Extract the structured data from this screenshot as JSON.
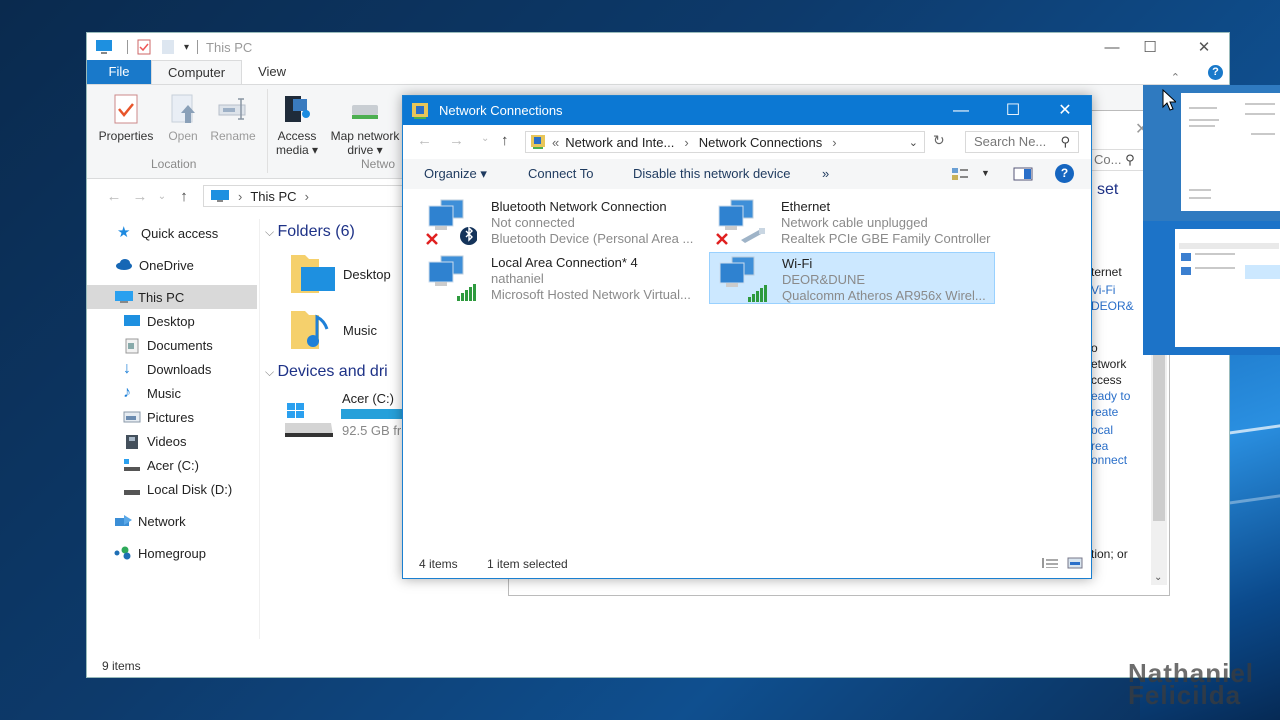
{
  "explorer": {
    "title": "This PC",
    "ribbon_tabs": [
      {
        "label": "File"
      },
      {
        "label": "Computer"
      },
      {
        "label": "View"
      }
    ],
    "ribbon_buttons": [
      {
        "label": "Properties",
        "enabled": true
      },
      {
        "label": "Open",
        "enabled": false
      },
      {
        "label": "Rename",
        "enabled": false
      },
      {
        "label": "Access media",
        "line1": "Access",
        "line2": "media ▾",
        "enabled": true
      },
      {
        "label": "Map network drive",
        "line1": "Map network",
        "line2": "drive ▾",
        "enabled": true
      }
    ],
    "ribbon_groups": [
      {
        "label": "Location"
      },
      {
        "label": "Netwo"
      }
    ],
    "address": {
      "crumb": "This PC",
      "sep": "›"
    },
    "nav_pane": [
      {
        "label": "Quick access",
        "icon": "star-icon"
      },
      {
        "label": "OneDrive",
        "icon": "cloud-icon"
      },
      {
        "label": "This PC",
        "icon": "computer-icon",
        "selected": true
      },
      {
        "label": "Desktop",
        "icon": "desktop-icon"
      },
      {
        "label": "Documents",
        "icon": "documents-icon"
      },
      {
        "label": "Downloads",
        "icon": "downloads-icon"
      },
      {
        "label": "Music",
        "icon": "music-icon"
      },
      {
        "label": "Pictures",
        "icon": "pictures-icon"
      },
      {
        "label": "Videos",
        "icon": "videos-icon"
      },
      {
        "label": "Acer (C:)",
        "icon": "drive-c-icon"
      },
      {
        "label": "Local Disk (D:)",
        "icon": "drive-d-icon"
      },
      {
        "label": "Network",
        "icon": "network-icon"
      },
      {
        "label": "Homegroup",
        "icon": "homegroup-icon"
      }
    ],
    "folders_header": "Folders (6)",
    "folders": [
      {
        "label": "Desktop"
      },
      {
        "label": "Music"
      }
    ],
    "devices_header": "Devices and dri",
    "drive": {
      "label": "Acer (C:)",
      "free": "92.5 GB fr"
    },
    "status": "9 items"
  },
  "network_connections": {
    "title": "Network Connections",
    "breadcrumb": [
      "«",
      "Network and Inte...",
      "›",
      "Network Connections",
      "›"
    ],
    "search_placeholder": "Search Ne...",
    "commands": [
      {
        "label": "Organize ▾"
      },
      {
        "label": "Connect To"
      },
      {
        "label": "Disable this network device"
      },
      {
        "label": "»"
      }
    ],
    "connections": [
      {
        "name": "Bluetooth Network Connection",
        "status": "Not connected",
        "device": "Bluetooth Device (Personal Area ...",
        "badge": "bluetooth",
        "disconnected": true,
        "selected": false
      },
      {
        "name": "Ethernet",
        "status": "Network cable unplugged",
        "device": "Realtek PCIe GBE Family Controller",
        "badge": "cable",
        "disconnected": true,
        "selected": false
      },
      {
        "name": "Local Area Connection* 4",
        "status": "nathaniel",
        "device": "Microsoft Hosted Network Virtual...",
        "badge": "signal",
        "disconnected": false,
        "selected": false
      },
      {
        "name": "Wi-Fi",
        "status": "DEOR&DUNE",
        "device": "Qualcomm Atheros AR956x Wirel...",
        "badge": "signal",
        "disconnected": false,
        "selected": true
      }
    ],
    "status_items": "4 items",
    "status_selected": "1 item selected"
  },
  "behind_window": {
    "search_partial": "Co...",
    "heading_partial": "set",
    "lines": [
      "ternet",
      "Vi-Fi",
      "DEOR&"
    ],
    "lines2": [
      "o",
      "etwork",
      "ccess"
    ],
    "links": [
      "eady to",
      "reate",
      "ocal",
      "rea",
      "onnect"
    ],
    "footer_partial": "tion; or"
  },
  "watermark": {
    "line1": "Nathaniel",
    "line2": "Felicilda"
  },
  "colors": {
    "accent": "#0c78d3",
    "selection": "#cce8ff",
    "link": "#1e3287"
  }
}
